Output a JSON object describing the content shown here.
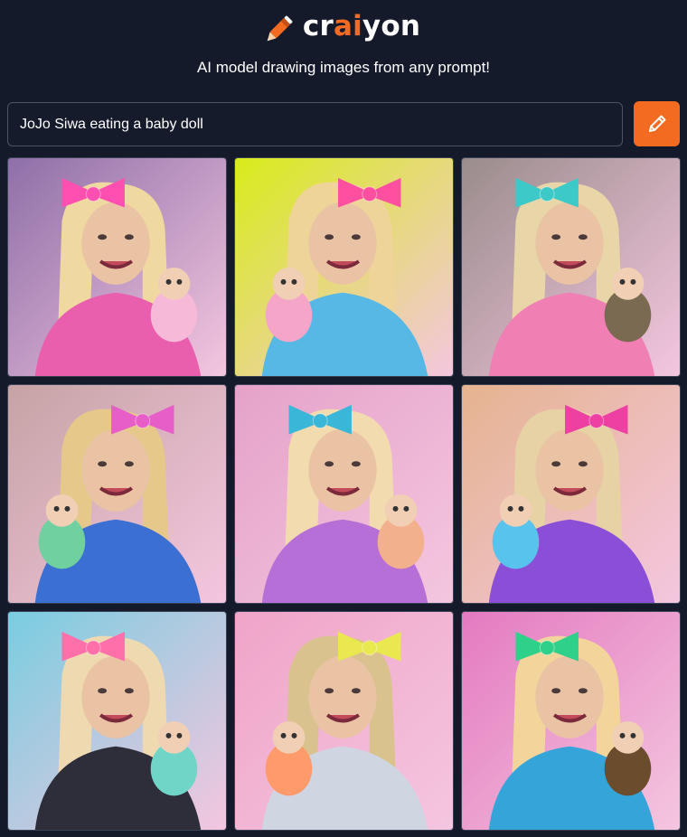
{
  "brand": {
    "prefix": "cr",
    "accent": "ai",
    "suffix": "yon",
    "accent_color": "#f36b21"
  },
  "tagline": "AI model drawing images from any prompt!",
  "prompt": {
    "value": "JoJo Siwa eating a baby doll"
  },
  "draw_button": {
    "icon": "pencil-icon"
  },
  "images": [
    {
      "id": "img-1",
      "bg": "#8e6fa8",
      "hair": "#f0d9a0",
      "bow": "#ff4fb0",
      "shirt": "#e95fae",
      "doll": "#f7b9d8"
    },
    {
      "id": "img-2",
      "bg": "#d8ec1a",
      "hair": "#efd49a",
      "bow": "#ff4fa0",
      "shirt": "#57b8e6",
      "doll": "#f5a6c8"
    },
    {
      "id": "img-3",
      "bg": "#9a8c8c",
      "hair": "#e8d6a8",
      "bow": "#3ec9c9",
      "shirt": "#f07fb4",
      "doll": "#7a6a52"
    },
    {
      "id": "img-4",
      "bg": "#c6a3a5",
      "hair": "#e6c98a",
      "bow": "#e85ec8",
      "shirt": "#3b6fd1",
      "doll": "#70d0a0"
    },
    {
      "id": "img-5",
      "bg": "#e5a2c9",
      "hair": "#f3dbb0",
      "bow": "#3ab7d8",
      "shirt": "#b56fd7",
      "doll": "#f2b08c"
    },
    {
      "id": "img-6",
      "bg": "#e5b38f",
      "hair": "#e7d2a5",
      "bow": "#ee3fa3",
      "shirt": "#8b4fd7",
      "doll": "#58c4ee"
    },
    {
      "id": "img-7",
      "bg": "#79cde0",
      "hair": "#efd9b0",
      "bow": "#ff6faa",
      "shirt": "#2e2d3a",
      "doll": "#6fd6c7"
    },
    {
      "id": "img-8",
      "bg": "#f0a4c8",
      "hair": "#d9c28d",
      "bow": "#e9e94f",
      "shirt": "#cfd6e2",
      "doll": "#ff9a6a"
    },
    {
      "id": "img-9",
      "bg": "#e47ac0",
      "hair": "#f3d59c",
      "bow": "#2fd08a",
      "shirt": "#35a4d9",
      "doll": "#6b4d2e"
    }
  ]
}
